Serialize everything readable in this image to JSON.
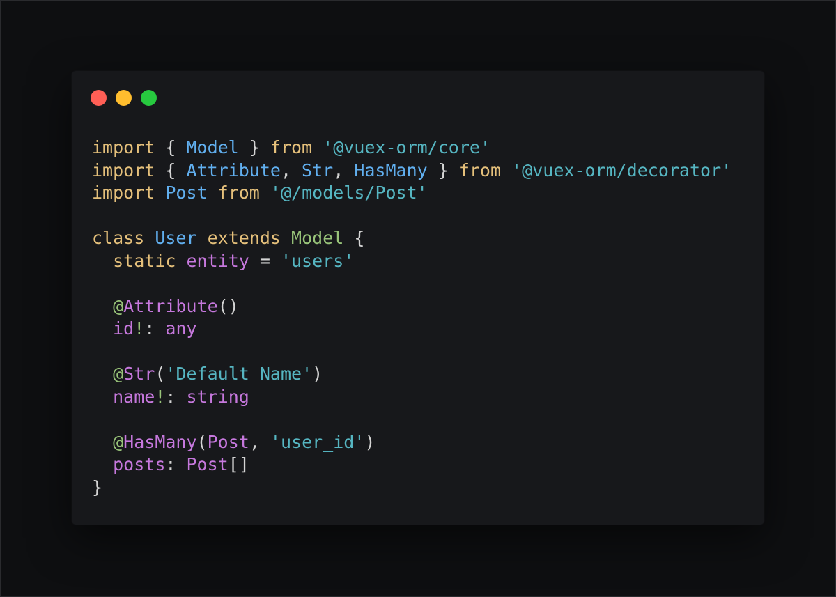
{
  "colors": {
    "background": "#0e0f11",
    "window": "#17181b",
    "close": "#ff5f56",
    "minimize": "#ffbd2e",
    "zoom": "#27c93f",
    "keyword": "#e5c07b",
    "type": "#61afef",
    "string": "#56b6c2",
    "decorator": "#98c379",
    "property": "#c678dd",
    "punctuation": "#d4d4d4"
  },
  "window_controls": [
    "close",
    "minimize",
    "zoom"
  ],
  "code_lines": [
    [
      [
        "import",
        "kw"
      ],
      [
        " { ",
        "punc"
      ],
      [
        "Model",
        "type"
      ],
      [
        " } ",
        "punc"
      ],
      [
        "from",
        "kw"
      ],
      [
        " ",
        "punc"
      ],
      [
        "'@vuex-orm/core'",
        "str"
      ]
    ],
    [
      [
        "import",
        "kw"
      ],
      [
        " { ",
        "punc"
      ],
      [
        "Attribute",
        "type"
      ],
      [
        ", ",
        "punc"
      ],
      [
        "Str",
        "type"
      ],
      [
        ", ",
        "punc"
      ],
      [
        "HasMany",
        "type"
      ],
      [
        " } ",
        "punc"
      ],
      [
        "from",
        "kw"
      ],
      [
        " ",
        "punc"
      ],
      [
        "'@vuex-orm/decorator'",
        "str"
      ]
    ],
    [
      [
        "import",
        "kw"
      ],
      [
        " ",
        "punc"
      ],
      [
        "Post",
        "type"
      ],
      [
        " ",
        "punc"
      ],
      [
        "from",
        "kw"
      ],
      [
        " ",
        "punc"
      ],
      [
        "'@/models/Post'",
        "str"
      ]
    ],
    [],
    [
      [
        "class",
        "kw"
      ],
      [
        " ",
        "punc"
      ],
      [
        "User",
        "type"
      ],
      [
        " ",
        "punc"
      ],
      [
        "extends",
        "kw"
      ],
      [
        " ",
        "punc"
      ],
      [
        "Model",
        "class"
      ],
      [
        " {",
        "punc"
      ]
    ],
    [
      [
        "  ",
        "punc"
      ],
      [
        "static",
        "kw"
      ],
      [
        " ",
        "punc"
      ],
      [
        "entity",
        "prop"
      ],
      [
        " = ",
        "punc"
      ],
      [
        "'users'",
        "str"
      ]
    ],
    [],
    [
      [
        "  ",
        "punc"
      ],
      [
        "@",
        "deco"
      ],
      [
        "Attribute",
        "prop"
      ],
      [
        "()",
        "punc"
      ]
    ],
    [
      [
        "  ",
        "punc"
      ],
      [
        "id",
        "prop"
      ],
      [
        "!",
        "bang"
      ],
      [
        ": ",
        "punc"
      ],
      [
        "any",
        "prop"
      ]
    ],
    [],
    [
      [
        "  ",
        "punc"
      ],
      [
        "@",
        "deco"
      ],
      [
        "Str",
        "prop"
      ],
      [
        "(",
        "punc"
      ],
      [
        "'Default Name'",
        "str"
      ],
      [
        ")",
        "punc"
      ]
    ],
    [
      [
        "  ",
        "punc"
      ],
      [
        "name",
        "prop"
      ],
      [
        "!",
        "bang"
      ],
      [
        ": ",
        "punc"
      ],
      [
        "string",
        "prop"
      ]
    ],
    [],
    [
      [
        "  ",
        "punc"
      ],
      [
        "@",
        "deco"
      ],
      [
        "HasMany",
        "prop"
      ],
      [
        "(",
        "punc"
      ],
      [
        "Post",
        "prop"
      ],
      [
        ", ",
        "punc"
      ],
      [
        "'user_id'",
        "str"
      ],
      [
        ")",
        "punc"
      ]
    ],
    [
      [
        "  ",
        "punc"
      ],
      [
        "posts",
        "prop"
      ],
      [
        ": ",
        "punc"
      ],
      [
        "Post",
        "prop"
      ],
      [
        "[]",
        "punc"
      ]
    ],
    [
      [
        "}",
        "punc"
      ]
    ]
  ]
}
